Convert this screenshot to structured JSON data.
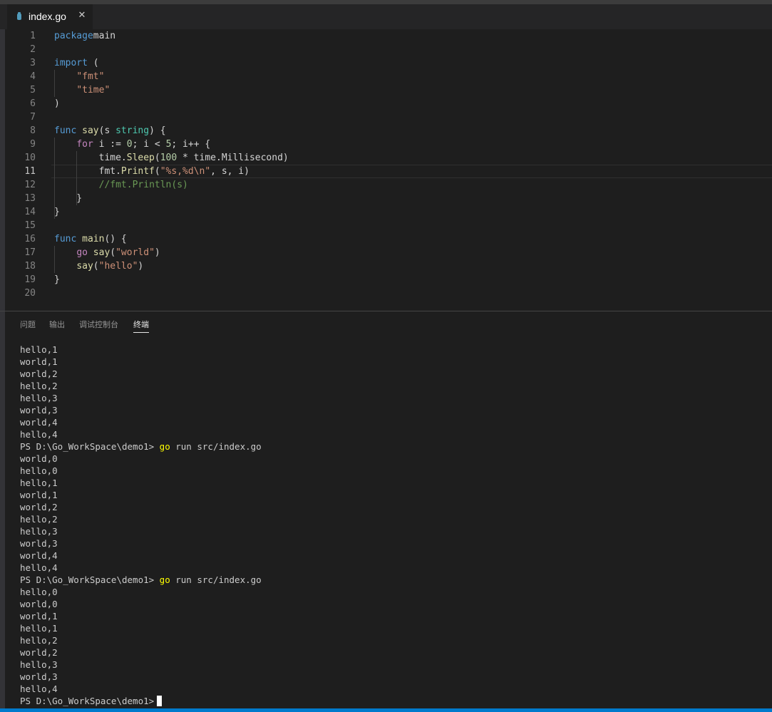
{
  "tab": {
    "filename": "index.go",
    "close_glyph": "✕",
    "icon": "go-file-icon"
  },
  "editor": {
    "active_line": 11,
    "lines": [
      [
        [
          "kw",
          "package"
        ],
        [
          "",
          "main"
        ]
      ],
      [],
      [
        [
          "kw",
          "import"
        ],
        [
          "",
          " ("
        ]
      ],
      [
        [
          "",
          "    "
        ],
        [
          "str",
          "\"fmt\""
        ]
      ],
      [
        [
          "",
          "    "
        ],
        [
          "str",
          "\"time\""
        ]
      ],
      [
        [
          "",
          ")"
        ]
      ],
      [],
      [
        [
          "kw",
          "func"
        ],
        [
          "",
          " "
        ],
        [
          "fn",
          "say"
        ],
        [
          "",
          "(s "
        ],
        [
          "typ",
          "string"
        ],
        [
          "",
          ") {"
        ]
      ],
      [
        [
          "",
          "    "
        ],
        [
          "ctrl",
          "for"
        ],
        [
          "",
          " i := "
        ],
        [
          "num",
          "0"
        ],
        [
          "",
          "; i < "
        ],
        [
          "num",
          "5"
        ],
        [
          "",
          "; i++ {"
        ]
      ],
      [
        [
          "",
          "        time."
        ],
        [
          "fn",
          "Sleep"
        ],
        [
          "",
          "("
        ],
        [
          "num",
          "100"
        ],
        [
          "",
          " * time.Millisecond)"
        ]
      ],
      [
        [
          "",
          "        fmt."
        ],
        [
          "fn",
          "Printf"
        ],
        [
          "",
          "("
        ],
        [
          "str",
          "\"%s,%d\\n\""
        ],
        [
          "",
          ", s, i)"
        ]
      ],
      [
        [
          "",
          "        "
        ],
        [
          "cmt",
          "//fmt.Println(s)"
        ]
      ],
      [
        [
          "",
          "    }"
        ]
      ],
      [
        [
          "",
          "}"
        ]
      ],
      [],
      [
        [
          "kw",
          "func"
        ],
        [
          "",
          " "
        ],
        [
          "fn",
          "main"
        ],
        [
          "",
          "() {"
        ]
      ],
      [
        [
          "",
          "    "
        ],
        [
          "ctrl",
          "go"
        ],
        [
          "",
          " "
        ],
        [
          "fn",
          "say"
        ],
        [
          "",
          "("
        ],
        [
          "str",
          "\"world\""
        ],
        [
          "",
          ")"
        ]
      ],
      [
        [
          "",
          "    "
        ],
        [
          "fn",
          "say"
        ],
        [
          "",
          "("
        ],
        [
          "str",
          "\"hello\""
        ],
        [
          "",
          ")"
        ]
      ],
      [
        [
          "",
          "}"
        ]
      ],
      []
    ]
  },
  "panel": {
    "tabs": [
      {
        "label": "问题",
        "name": "problems",
        "active": false
      },
      {
        "label": "输出",
        "name": "output",
        "active": false
      },
      {
        "label": "调试控制台",
        "name": "debug-console",
        "active": false
      },
      {
        "label": "终端",
        "name": "terminal",
        "active": true
      }
    ]
  },
  "terminal": {
    "lines": [
      {
        "text": "hello,1"
      },
      {
        "text": "world,1"
      },
      {
        "text": "world,2"
      },
      {
        "text": "hello,2"
      },
      {
        "text": "hello,3"
      },
      {
        "text": "world,3"
      },
      {
        "text": "world,4"
      },
      {
        "text": "hello,4"
      },
      {
        "prompt": "PS D:\\Go_WorkSpace\\demo1> ",
        "cmd": "go",
        "args": " run src/index.go"
      },
      {
        "text": "world,0"
      },
      {
        "text": "hello,0"
      },
      {
        "text": "hello,1"
      },
      {
        "text": "world,1"
      },
      {
        "text": "world,2"
      },
      {
        "text": "hello,2"
      },
      {
        "text": "hello,3"
      },
      {
        "text": "world,3"
      },
      {
        "text": "world,4"
      },
      {
        "text": "hello,4"
      },
      {
        "prompt": "PS D:\\Go_WorkSpace\\demo1> ",
        "cmd": "go",
        "args": " run src/index.go"
      },
      {
        "text": "hello,0"
      },
      {
        "text": "world,0"
      },
      {
        "text": "world,1"
      },
      {
        "text": "hello,1"
      },
      {
        "text": "hello,2"
      },
      {
        "text": "world,2"
      },
      {
        "text": "hello,3"
      },
      {
        "text": "world,3"
      },
      {
        "text": "hello,4"
      },
      {
        "prompt": "PS D:\\Go_WorkSpace\\demo1>",
        "cursor": true
      }
    ]
  },
  "colors": {
    "keyword": "#569cd6",
    "control": "#c586c0",
    "string": "#ce9178",
    "number": "#b5cea8",
    "function": "#dcdcaa",
    "type": "#4ec9b0",
    "comment": "#6a9955",
    "terminal_command": "#ffff00",
    "status_bar": "#007acc"
  }
}
